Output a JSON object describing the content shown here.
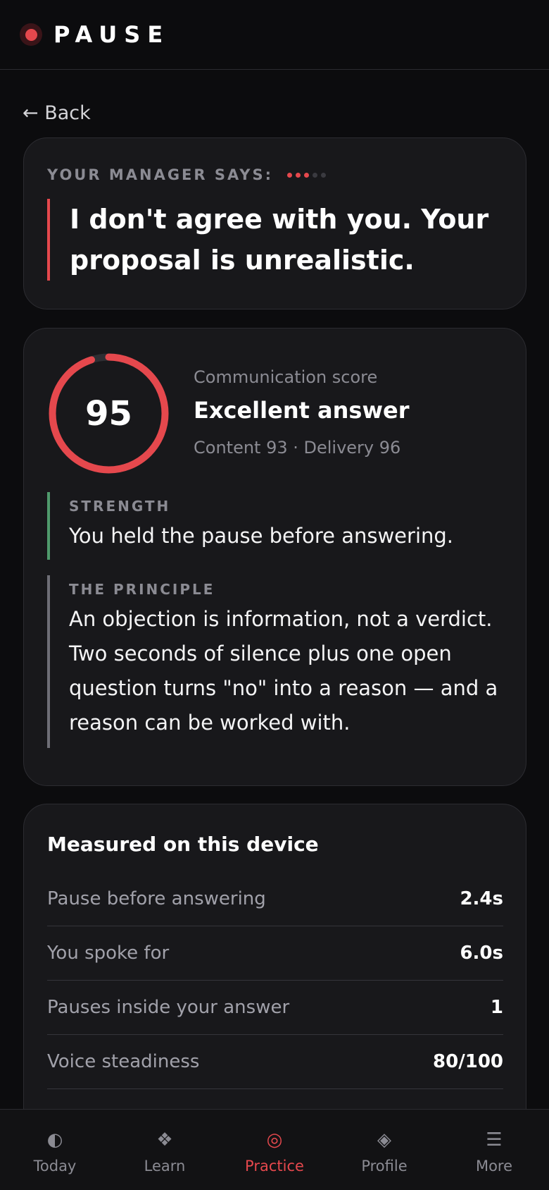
{
  "app": {
    "name": "PAUSE"
  },
  "nav_back": "← Back",
  "prompt_card": {
    "label": "YOUR MANAGER SAYS:",
    "progress": {
      "total": 5,
      "current": 3
    },
    "quote": "I don't agree with you. Your proposal is unrealistic."
  },
  "score_card": {
    "score": "95",
    "score_fraction": 0.95,
    "label": "Communication score",
    "verdict": "Excellent answer",
    "breakdown": "Content 93 · Delivery 96",
    "strength": {
      "title": "STRENGTH",
      "body": "You held the pause before answering."
    },
    "principle": {
      "title": "THE PRINCIPLE",
      "body": "An objection is information, not a verdict. Two seconds of silence plus one open question turns \"no\" into a reason — and a reason can be worked with."
    }
  },
  "measured": {
    "title": "Measured on this device",
    "rows": [
      {
        "label": "Pause before answering",
        "value": "2.4s"
      },
      {
        "label": "You spoke for",
        "value": "6.0s"
      },
      {
        "label": "Pauses inside your answer",
        "value": "1"
      },
      {
        "label": "Voice steadiness",
        "value": "80/100"
      }
    ]
  },
  "bottom_nav": [
    {
      "label": "Today",
      "icon": "◐",
      "icon_name": "half-circle-icon",
      "active": false
    },
    {
      "label": "Learn",
      "icon": "❖",
      "icon_name": "diamonds-icon",
      "active": false
    },
    {
      "label": "Practice",
      "icon": "◎",
      "icon_name": "target-icon",
      "active": true
    },
    {
      "label": "Profile",
      "icon": "◈",
      "icon_name": "diamond-icon",
      "active": false
    },
    {
      "label": "More",
      "icon": "☰",
      "icon_name": "menu-icon",
      "active": false
    }
  ],
  "colors": {
    "accent": "#e5484d",
    "strength": "#4f9a6c",
    "background": "#0c0c0e",
    "card": "#18181b"
  }
}
